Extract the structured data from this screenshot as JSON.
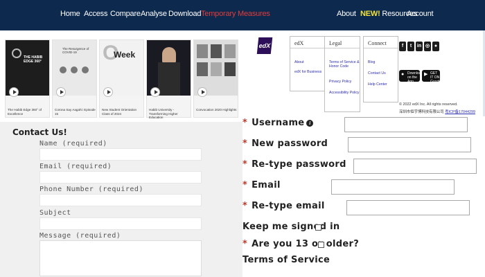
{
  "nav": {
    "items": [
      "Home",
      "Access",
      "Compare",
      "Analyse",
      "Download",
      "Temporary Measures"
    ],
    "right_items": [
      "About",
      "Resources",
      "Account"
    ],
    "new_label": "NEW!",
    "bg_color": "#0d2a4e",
    "active_color": "#e23b3b"
  },
  "videos": [
    {
      "thumb_text": "THE HABIB EDGE 360°",
      "caption": "The Habib Edge 360° of Excellence"
    },
    {
      "thumb_text": "The Resurgence of COVID-19",
      "caption": "Corona Say Aagahi: Episode 15"
    },
    {
      "thumb_text": "Week",
      "caption": "New Student Orientation Class of 2024"
    },
    {
      "thumb_text": "",
      "caption": "Habib University - Transforming Higher Education"
    },
    {
      "thumb_text": "",
      "caption": "Convocation 2020 Highlights"
    }
  ],
  "contact": {
    "title": "Contact Us!",
    "fields": [
      "Name (required)",
      "Email (required)",
      "Phone Number (required)",
      "Subject",
      "Message (required)"
    ]
  },
  "edx": {
    "logo": "edX",
    "col1_head": "edX",
    "col1_links": [
      "About",
      "edX for Business"
    ],
    "col2_head": "Legal",
    "col2_links": [
      "Terms of Service & Honor Code",
      "Privacy Policy",
      "Accessibility Policy"
    ],
    "col3_head": "Connect",
    "col3_links": [
      "Blog",
      "Contact Us",
      "Help Center"
    ],
    "social": [
      "facebook-icon",
      "twitter-icon",
      "linkedin-icon",
      "instagram-icon",
      "reddit-icon"
    ],
    "appstore_line1": "Download on the",
    "appstore_line2": "App Store",
    "googleplay_line1": "GET IT ON",
    "googleplay_line2": "Google Play",
    "copyright": "© 2022 edX Inc. All rights reserved.",
    "icp_prefix": "深圳市恒宇博科技有限公司",
    "icp_link": "粤ICP备17044299"
  },
  "register": {
    "labels": [
      "Username",
      "New password",
      "Re-type password",
      "Email",
      "Re-type email"
    ],
    "keep_signed": "Keep me signed in",
    "age": "Are you 13 or older?",
    "terms": "Terms of Service"
  }
}
